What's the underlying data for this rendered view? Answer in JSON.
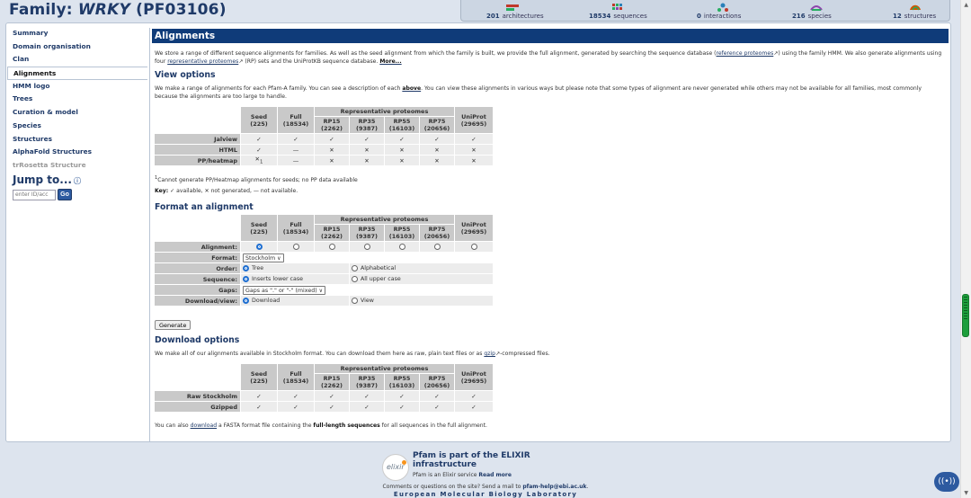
{
  "header": {
    "title_prefix": "Family: ",
    "title_name": "WRKY",
    "title_suffix": " (PF03106)"
  },
  "stats": [
    {
      "count": "201",
      "label": "architectures",
      "icon": "architectures-icon",
      "color": "#c0392b"
    },
    {
      "count": "18534",
      "label": "sequences",
      "icon": "sequences-icon",
      "color": "#27ae60"
    },
    {
      "count": "0",
      "label": "interactions",
      "icon": "interactions-icon",
      "color": "#2980b9"
    },
    {
      "count": "216",
      "label": "species",
      "icon": "species-icon",
      "color": "#8e44ad"
    },
    {
      "count": "12",
      "label": "structures",
      "icon": "structures-icon",
      "color": "#d35400"
    }
  ],
  "sidebar": {
    "items": [
      {
        "label": "Summary"
      },
      {
        "label": "Domain organisation"
      },
      {
        "label": "Clan"
      },
      {
        "label": "Alignments"
      },
      {
        "label": "HMM logo"
      },
      {
        "label": "Trees"
      },
      {
        "label": "Curation & model"
      },
      {
        "label": "Species"
      },
      {
        "label": "Structures"
      },
      {
        "label": "AlphaFold Structures"
      },
      {
        "label": "trRosetta Structure"
      }
    ],
    "jump_title": "Jump to...",
    "jump_placeholder": "enter ID/acc",
    "go_label": "Go"
  },
  "section": {
    "title": "Alignments",
    "intro_1": "We store a range of different sequence alignments for families. As well as the seed alignment from which the family is built, we provide the full alignment, generated by searching the sequence database (",
    "intro_link_1": "reference proteomes",
    "intro_2": ") using the family HMM. We also generate alignments using four ",
    "intro_link_2": "representative proteomes",
    "intro_3": " (RP) sets and the UniProtKB sequence database. ",
    "intro_more": "More..."
  },
  "view_options": {
    "heading": "View options",
    "text_1": "We make a range of alignments for each Pfam-A family. You can see a description of each ",
    "text_link": "above",
    "text_2": ". You can view these alignments in various ways but please note that some types of alignment are never generated while others may not be available for all families, most commonly because the alignments are too large to handle.",
    "footnote": "Cannot generate PP/Heatmap alignments for seeds; no PP data available",
    "footnote_mark": "1",
    "key_label": "Key:",
    "key_text": " ✓ available, ✕ not generated, — not available.",
    "rows": [
      {
        "label": "Jalview",
        "cells": [
          "✓",
          "✓",
          "✓",
          "✓",
          "✓",
          "✓",
          "✓"
        ]
      },
      {
        "label": "HTML",
        "cells": [
          "✓",
          "—",
          "✕",
          "✕",
          "✕",
          "✕",
          "✕"
        ]
      },
      {
        "label": "PP/heatmap",
        "cells": [
          "✕",
          "—",
          "✕",
          "✕",
          "✕",
          "✕",
          "✕"
        ]
      }
    ]
  },
  "columns": {
    "seed": "Seed",
    "seed_n": "(225)",
    "full": "Full",
    "full_n": "(18534)",
    "rep_header": "Representative proteomes",
    "rp15": "RP15",
    "rp15_n": "(2262)",
    "rp35": "RP35",
    "rp35_n": "(9387)",
    "rp55": "RP55",
    "rp55_n": "(16103)",
    "rp75": "RP75",
    "rp75_n": "(20656)",
    "uniprot": "UniProt",
    "uniprot_n": "(29695)"
  },
  "format": {
    "heading": "Format an alignment",
    "alignment_label": "Alignment:",
    "format_label": "Format:",
    "format_value": "Stockholm",
    "order_label": "Order:",
    "order_opt1": "Tree",
    "order_opt2": "Alphabetical",
    "sequence_label": "Sequence:",
    "seq_opt1": "Inserts lower case",
    "seq_opt2": "All upper case",
    "gaps_label": "Gaps:",
    "gaps_value": "Gaps as \".\" or \"-\" (mixed)",
    "download_label": "Download/view:",
    "dl_opt1": "Download",
    "dl_opt2": "View",
    "generate_label": "Generate"
  },
  "download": {
    "heading": "Download options",
    "text_1": "We make all of our alignments available in Stockholm format. You can download them here as raw, plain text files or as ",
    "text_link": "gzip",
    "text_2": "-compressed files.",
    "rows": [
      {
        "label": "Raw Stockholm",
        "cells": [
          "✓",
          "✓",
          "✓",
          "✓",
          "✓",
          "✓",
          "✓"
        ]
      },
      {
        "label": "Gzipped",
        "cells": [
          "✓",
          "✓",
          "✓",
          "✓",
          "✓",
          "✓",
          "✓"
        ]
      }
    ],
    "fasta_1": "You can also ",
    "fasta_link": "download",
    "fasta_2": " a FASTA format file containing the ",
    "fasta_bold": "full-length sequences",
    "fasta_3": " for all sequences in the full alignment."
  },
  "footer": {
    "elixir_logo_text": "elixir",
    "elixir_heading_1": "Pfam is part of the ELIXIR",
    "elixir_heading_2": "infrastructure",
    "elixir_sub": "Pfam is an Elixir service ",
    "elixir_more": "Read more",
    "contact_text": "Comments or questions on the site? Send a mail to ",
    "contact_email": "pfam-help@ebi.ac.uk",
    "contact_end": ".",
    "embl": "European Molecular Biology Laboratory"
  }
}
